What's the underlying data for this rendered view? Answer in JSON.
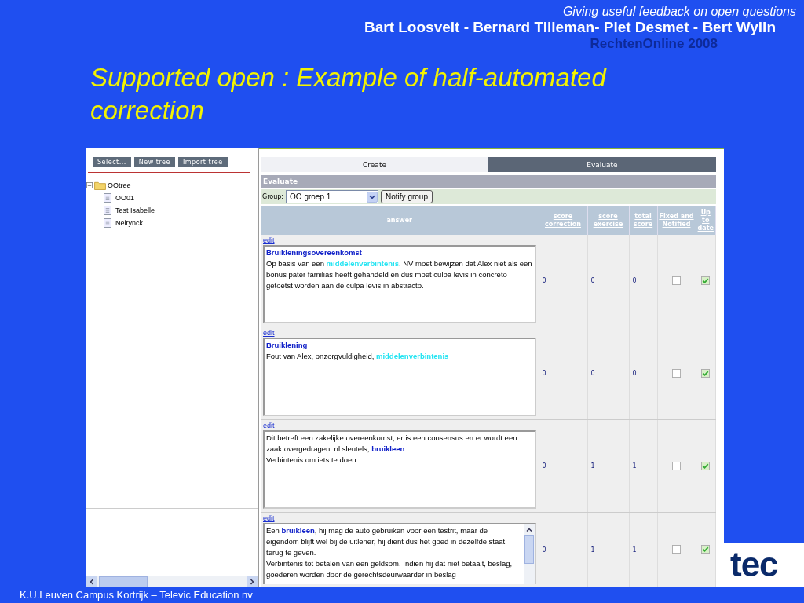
{
  "slide": {
    "subtitle": "Giving useful feedback on open questions",
    "authors": "Bart Loosvelt  - Bernard Tilleman- Piet Desmet  - Bert Wylin",
    "event": "RechtenOnline 2008",
    "title": "Supported open : Example of half-automated correction",
    "footer": "K.U.Leuven Campus Kortrijk – Televic Education nv",
    "logo": "tec"
  },
  "app": {
    "tree_buttons": [
      "Select...",
      "New tree",
      "Import tree"
    ],
    "tree": {
      "label": "OOtree",
      "expanded": true,
      "children": [
        {
          "label": "OO01"
        },
        {
          "label": "Test Isabelle"
        },
        {
          "label": "Neirynck"
        }
      ]
    },
    "tabs": [
      {
        "label": "Create",
        "selected": false
      },
      {
        "label": "Evaluate",
        "selected": true
      }
    ],
    "section_title": "Evaluate",
    "group_label": "Group:",
    "group_value": "OO groep 1",
    "notify_button": "Notify group",
    "columns": [
      {
        "label": "answer",
        "link": false
      },
      {
        "label": "score correction",
        "link": true
      },
      {
        "label": "score exercise",
        "link": true
      },
      {
        "label": "total score",
        "link": true
      },
      {
        "label": "Fixed and Notified",
        "link": true
      },
      {
        "label": "Up to date",
        "link": true
      }
    ],
    "rows": [
      {
        "link": "edit",
        "scrollable": false,
        "paragraphs": [
          [
            {
              "text": "Bruikleningsovereenkomst",
              "kind": "concept"
            }
          ],
          [
            {
              "text": "Op basis van een ",
              "kind": "plain"
            },
            {
              "text": "middelenverbintenis",
              "kind": "match"
            },
            {
              "text": ". NV moet bewijzen dat Alex niet als een bonus pater familias heeft gehandeld en dus moet culpa levis in concreto getoetst worden aan de culpa levis in abstracto.",
              "kind": "plain"
            }
          ]
        ],
        "score_correction": "0",
        "score_exercise": "0",
        "total_score": "0",
        "fixed_notified": false,
        "up_to_date": true
      },
      {
        "link": "edit",
        "scrollable": false,
        "paragraphs": [
          [
            {
              "text": "Bruiklening",
              "kind": "concept"
            }
          ],
          [
            {
              "text": "Fout van Alex, onzorgvuldigheid, ",
              "kind": "plain"
            },
            {
              "text": "middelenverbintenis",
              "kind": "match"
            }
          ]
        ],
        "score_correction": "0",
        "score_exercise": "0",
        "total_score": "0",
        "fixed_notified": false,
        "up_to_date": true
      },
      {
        "link": "edit",
        "scrollable": false,
        "paragraphs": [
          [
            {
              "text": "Dit betreft een zakelijke overeenkomst, er is een consensus en er wordt een zaak overgedragen, nl sleutels, ",
              "kind": "plain"
            },
            {
              "text": "bruikleen",
              "kind": "concept"
            }
          ],
          [
            {
              "text": "Verbintenis om iets te doen",
              "kind": "plain"
            }
          ]
        ],
        "score_correction": "0",
        "score_exercise": "1",
        "total_score": "1",
        "fixed_notified": false,
        "up_to_date": true
      },
      {
        "link": "edit",
        "scrollable": true,
        "paragraphs": [
          [
            {
              "text": "Een ",
              "kind": "plain"
            },
            {
              "text": "bruikleen",
              "kind": "concept"
            },
            {
              "text": ", hij mag de auto gebruiken voor een testrit, maar de eigendom blijft wel bij de uitlener, hij dient dus het goed in dezelfde staat terug te geven.",
              "kind": "plain"
            }
          ],
          [
            {
              "text": "Verbintenis tot betalen van een geldsom. Indien hij dat niet betaalt, beslag, goederen worden door de gerechtsdeurwaarder in beslag",
              "kind": "plain"
            }
          ]
        ],
        "score_correction": "0",
        "score_exercise": "1",
        "total_score": "1",
        "fixed_notified": false,
        "up_to_date": true
      }
    ]
  }
}
